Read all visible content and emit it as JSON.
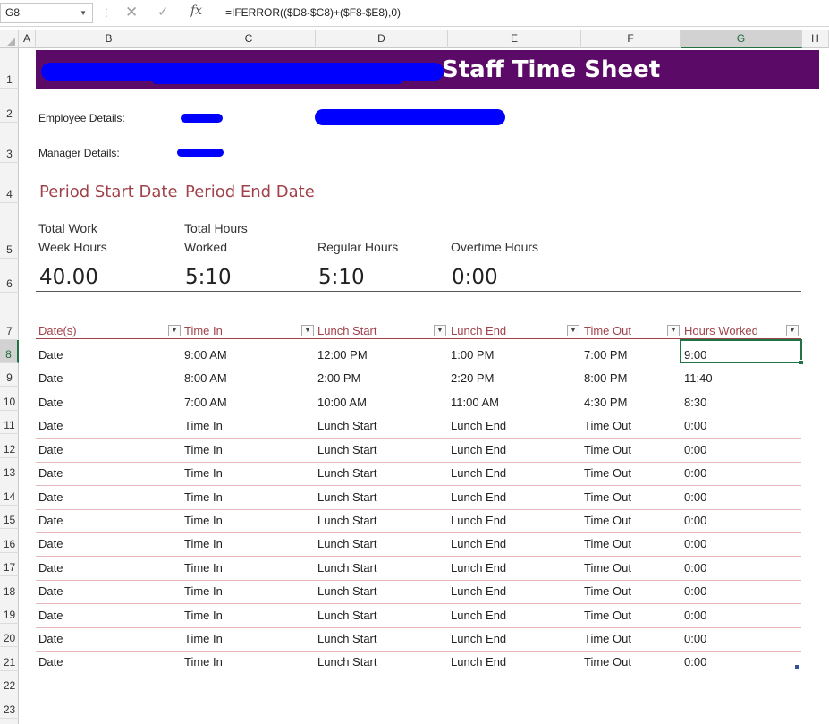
{
  "formula_bar": {
    "name_box": "G8",
    "name_box_dropdown": "▼",
    "grip": "⋮",
    "cancel_glyph": "✕",
    "enter_glyph": "✓",
    "fx": "fx",
    "formula": "=IFERROR(($D8-$C8)+($F8-$E8),0)"
  },
  "columns": [
    "A",
    "B",
    "C",
    "D",
    "E",
    "F",
    "G",
    "H"
  ],
  "rows": [
    "1",
    "2",
    "3",
    "4",
    "5",
    "6",
    "7",
    "8",
    "9",
    "10",
    "11",
    "12",
    "13",
    "14",
    "15",
    "16",
    "17",
    "18",
    "19",
    "20",
    "21",
    "22",
    "23"
  ],
  "selected_cell": "G8",
  "title": "Staff Time Sheet",
  "details": {
    "employee_label": "Employee Details:",
    "manager_label": "Manager Details:"
  },
  "period": {
    "start_label": "Period Start Date",
    "end_label": "Period End Date"
  },
  "summary": {
    "total_work_week_label_1": "Total Work",
    "total_work_week_label_2": "Week Hours",
    "total_hours_label_1": "Total Hours",
    "total_hours_label_2": "Worked",
    "regular_label": "Regular Hours",
    "overtime_label": "Overtime Hours",
    "total_work_week_value": "40.00",
    "total_hours_value": "5:10",
    "regular_value": "5:10",
    "overtime_value": "0:00"
  },
  "table": {
    "headers": [
      "Date(s)",
      "Time In",
      "Lunch Start",
      "Lunch End",
      "Time Out",
      "Hours Worked"
    ],
    "filter_glyph": "▼",
    "rows": [
      [
        "Date",
        "9:00 AM",
        "12:00 PM",
        "1:00 PM",
        "7:00 PM",
        "9:00"
      ],
      [
        "Date",
        "8:00 AM",
        "2:00 PM",
        "2:20 PM",
        "8:00 PM",
        "11:40"
      ],
      [
        "Date",
        "7:00 AM",
        "10:00 AM",
        "11:00 AM",
        "4:30 PM",
        "8:30"
      ],
      [
        "Date",
        "Time In",
        "Lunch Start",
        "Lunch End",
        "Time Out",
        "0:00"
      ],
      [
        "Date",
        "Time In",
        "Lunch Start",
        "Lunch End",
        "Time Out",
        "0:00"
      ],
      [
        "Date",
        "Time In",
        "Lunch Start",
        "Lunch End",
        "Time Out",
        "0:00"
      ],
      [
        "Date",
        "Time In",
        "Lunch Start",
        "Lunch End",
        "Time Out",
        "0:00"
      ],
      [
        "Date",
        "Time In",
        "Lunch Start",
        "Lunch End",
        "Time Out",
        "0:00"
      ],
      [
        "Date",
        "Time In",
        "Lunch Start",
        "Lunch End",
        "Time Out",
        "0:00"
      ],
      [
        "Date",
        "Time In",
        "Lunch Start",
        "Lunch End",
        "Time Out",
        "0:00"
      ],
      [
        "Date",
        "Time In",
        "Lunch Start",
        "Lunch End",
        "Time Out",
        "0:00"
      ],
      [
        "Date",
        "Time In",
        "Lunch Start",
        "Lunch End",
        "Time Out",
        "0:00"
      ],
      [
        "Date",
        "Time In",
        "Lunch Start",
        "Lunch End",
        "Time Out",
        "0:00"
      ],
      [
        "Date",
        "Time In",
        "Lunch Start",
        "Lunch End",
        "Time Out",
        "0:00"
      ]
    ]
  },
  "colors": {
    "title_band": "#5c0a67",
    "title_text": "#ffffff",
    "accent_text": "#a0424a",
    "redaction": "#0000ff",
    "selection": "#217346"
  }
}
